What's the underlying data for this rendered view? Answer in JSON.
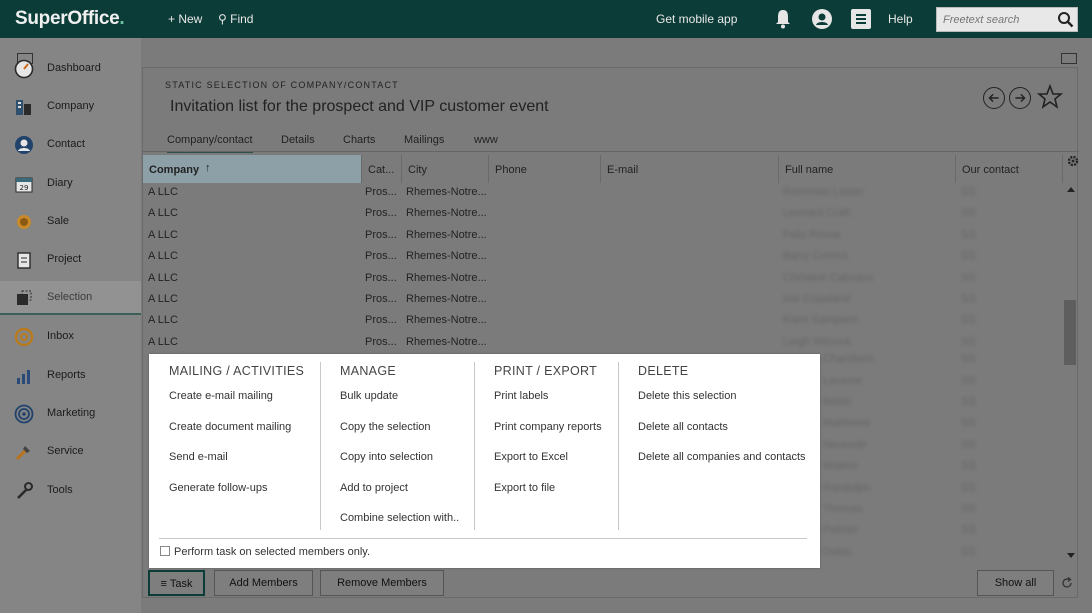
{
  "app": {
    "logo": "SuperOffice",
    "logo_dot": "."
  },
  "topbar": {
    "new": "+ New",
    "find": "⚲ Find",
    "mobile": "Get mobile app",
    "help": "Help",
    "search_placeholder": "Freetext search"
  },
  "sidebar": {
    "items": [
      {
        "label": "Dashboard",
        "icon": "dashboard-icon"
      },
      {
        "label": "Company",
        "icon": "company-icon"
      },
      {
        "label": "Contact",
        "icon": "contact-icon"
      },
      {
        "label": "Diary",
        "icon": "diary-icon",
        "icon_text": "29"
      },
      {
        "label": "Sale",
        "icon": "sale-icon"
      },
      {
        "label": "Project",
        "icon": "project-icon"
      },
      {
        "label": "Selection",
        "icon": "selection-icon"
      },
      {
        "label": "Inbox",
        "icon": "inbox-icon"
      },
      {
        "label": "Reports",
        "icon": "reports-icon"
      },
      {
        "label": "Marketing",
        "icon": "marketing-icon"
      },
      {
        "label": "Service",
        "icon": "service-icon"
      },
      {
        "label": "Tools",
        "icon": "tools-icon"
      }
    ],
    "active": "Selection"
  },
  "panel": {
    "subtitle": "STATIC SELECTION OF COMPANY/CONTACT",
    "title": "Invitation list for the prospect and VIP customer event",
    "tabs": [
      "Company/contact",
      "Details",
      "Charts",
      "Mailings",
      "www"
    ],
    "active_tab": "Company/contact"
  },
  "grid": {
    "columns": [
      "Company",
      "Cat...",
      "City",
      "Phone",
      "E-mail",
      "Full name",
      "Our contact"
    ],
    "sort_arrow": "↑",
    "rows": [
      {
        "company": "A LLC",
        "cat": "Pros...",
        "city": "Rhemes-Notre...",
        "name": "Rommelo Laster",
        "contact": "SS"
      },
      {
        "company": "A LLC",
        "cat": "Pros...",
        "city": "Rhemes-Notre...",
        "name": "Leonard Craft",
        "contact": "SS"
      },
      {
        "company": "A LLC",
        "cat": "Pros...",
        "city": "Rhemes-Notre...",
        "name": "Felix Rosse",
        "contact": "SS"
      },
      {
        "company": "A LLC",
        "cat": "Pros...",
        "city": "Rhemes-Notre...",
        "name": "Barry Corrins",
        "contact": "SS"
      },
      {
        "company": "A LLC",
        "cat": "Pros...",
        "city": "Rhemes-Notre...",
        "name": "Christine Calmans",
        "contact": "SS"
      },
      {
        "company": "A LLC",
        "cat": "Pros...",
        "city": "Rhemes-Notre...",
        "name": "Ivie Copeland",
        "contact": "SS"
      },
      {
        "company": "A LLC",
        "cat": "Pros...",
        "city": "Rhemes-Notre...",
        "name": "Klare Sampson",
        "contact": "SS"
      },
      {
        "company": "A LLC",
        "cat": "Pros...",
        "city": "Rhemes-Notre...",
        "name": "Leigh Wilcock",
        "contact": "SS"
      }
    ],
    "hidden_names": [
      "Chambers",
      "Laxeme",
      "Biddo",
      "Matthews",
      "Nevesde",
      "Waters",
      "Randolph",
      "Thomas",
      "Palmer",
      "Doles"
    ]
  },
  "popup": {
    "columns": [
      {
        "title": "MAILING / ACTIVITIES",
        "items": [
          "Create e-mail mailing",
          "Create document mailing",
          "Send e-mail",
          "Generate follow-ups"
        ]
      },
      {
        "title": "MANAGE",
        "items": [
          "Bulk update",
          "Copy the selection",
          "Copy into selection",
          "Add to project",
          "Combine selection with.."
        ]
      },
      {
        "title": "PRINT / EXPORT",
        "items": [
          "Print labels",
          "Print company reports",
          "Export to Excel",
          "Export to file"
        ]
      },
      {
        "title": "DELETE",
        "items": [
          "Delete this selection",
          "Delete all contacts",
          "Delete all companies and contacts"
        ]
      }
    ],
    "perform_label": "Perform task on selected members only."
  },
  "bottombar": {
    "task": "Task",
    "add": "Add Members",
    "remove": "Remove Members",
    "show_all": "Show all"
  }
}
